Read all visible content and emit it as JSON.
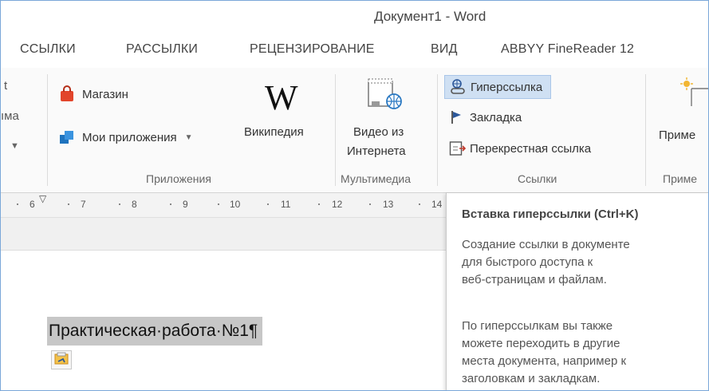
{
  "window": {
    "title": "Документ1 - Word"
  },
  "tabs": [
    "ССЫЛКИ",
    "РАССЫЛКИ",
    "РЕЦЕНЗИРОВАНИЕ",
    "ВИД",
    "ABBYY FineReader 12"
  ],
  "ribbon": {
    "left_partial": {
      "line1": "t",
      "line2": "ıма"
    },
    "apps": {
      "store": "Магазин",
      "my_apps": "Мои приложения",
      "wikipedia": "Википедия",
      "group": "Приложения"
    },
    "media": {
      "video_line1": "Видео из",
      "video_line2": "Интернета",
      "group": "Мультимедиа"
    },
    "links": {
      "hyperlink": "Гиперссылка",
      "bookmark": "Закладка",
      "cross_ref": "Перекрестная ссылка",
      "group": "Ссылки"
    },
    "notes_partial": {
      "label": "Приме",
      "group": "Приме"
    }
  },
  "ruler": [
    "6",
    "7",
    "8",
    "9",
    "10",
    "11",
    "12",
    "13",
    "14"
  ],
  "document": {
    "heading": "Практическая·работа·№1¶"
  },
  "tooltip": {
    "title": "Вставка гиперссылки (Ctrl+K)",
    "p1": [
      "Создание ссылки в документе",
      "для быстрого доступа к",
      "веб-страницам и файлам."
    ],
    "p2": [
      "По гиперссылкам вы также",
      "можете переходить в другие",
      "места документа, например к",
      "заголовкам и закладкам."
    ]
  },
  "colors": {
    "accent": "#2b579a",
    "hover": "#cfe0f3",
    "selection": "#c7c7c7"
  }
}
